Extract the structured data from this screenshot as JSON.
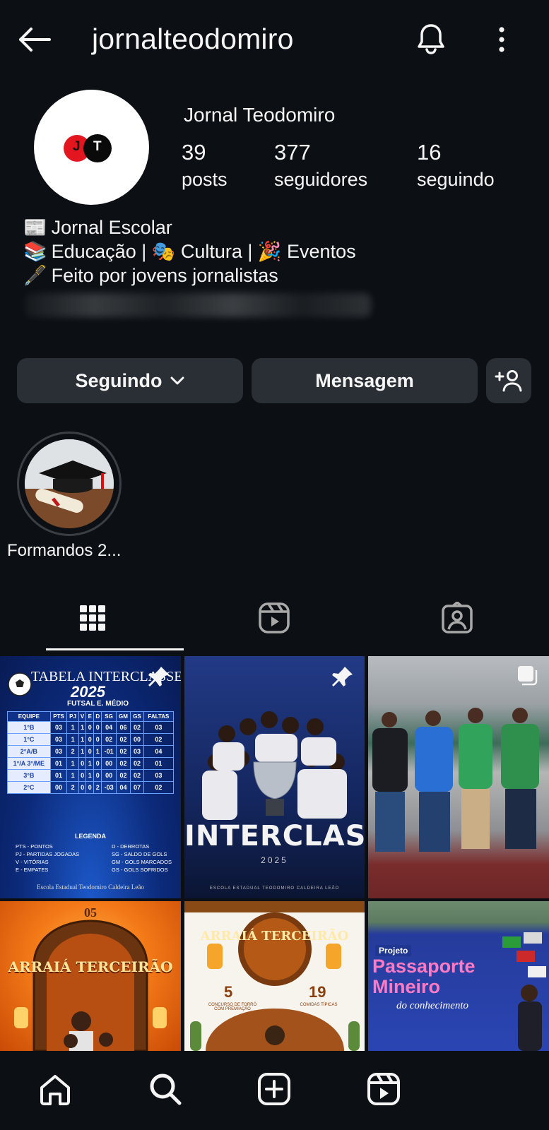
{
  "header": {
    "username": "jornalteodomiro",
    "icons": {
      "back": "arrow-left-icon",
      "bell": "bell-icon",
      "more": "more-vertical-icon"
    }
  },
  "profile": {
    "display_name": "Jornal Teodomiro",
    "avatar_logo": {
      "left_letter": "J",
      "right_letter": "T",
      "left_color": "#e3161f",
      "right_color": "#0a0a0a"
    },
    "stats": [
      {
        "value": "39",
        "label": "posts"
      },
      {
        "value": "377",
        "label": "seguidores"
      },
      {
        "value": "16",
        "label": "seguindo"
      }
    ],
    "bio": [
      {
        "emoji": "📰",
        "text": "Jornal Escolar"
      },
      {
        "emoji": "📚",
        "text": "Educação | 🎭 Cultura | 🎉 Eventos"
      },
      {
        "emoji": "🖋️",
        "text": "Feito por jovens jornalistas"
      }
    ]
  },
  "actions": {
    "following_label": "Seguindo",
    "message_label": "Mensagem"
  },
  "highlights": [
    {
      "label": "Formandos 2..."
    }
  ],
  "tabs": [
    {
      "name": "grid",
      "active": true
    },
    {
      "name": "reels",
      "active": false
    },
    {
      "name": "tagged",
      "active": false
    }
  ],
  "posts": [
    {
      "title": "TABELA INTERCLASSE",
      "year": "2025",
      "subtitle": "FUTSAL E. MÉDIO",
      "headers": [
        "EQUIPE",
        "PTS",
        "PJ",
        "V",
        "E",
        "D",
        "SG",
        "GM",
        "GS",
        "FALTAS"
      ],
      "rows": [
        [
          "1°B",
          "03",
          "1",
          "1",
          "0",
          "0",
          "04",
          "06",
          "02",
          "03"
        ],
        [
          "1°C",
          "03",
          "1",
          "1",
          "0",
          "0",
          "02",
          "02",
          "00",
          "02"
        ],
        [
          "2°A/B",
          "03",
          "2",
          "1",
          "0",
          "1",
          "-01",
          "02",
          "03",
          "04"
        ],
        [
          "1°/A 3°/ME",
          "01",
          "1",
          "0",
          "1",
          "0",
          "00",
          "02",
          "02",
          "01"
        ],
        [
          "3°B",
          "01",
          "1",
          "0",
          "1",
          "0",
          "00",
          "02",
          "02",
          "03"
        ],
        [
          "2°C",
          "00",
          "2",
          "0",
          "0",
          "2",
          "-03",
          "04",
          "07",
          "02"
        ]
      ],
      "legend_title": "LEGENDA",
      "legend": [
        "PTS - PONTOS",
        "PJ - PARTIDAS JOGADAS",
        "V - VITÓRIAS",
        "E - EMPATES",
        "D - DERROTAS",
        "SG - SALDO DE GOLS",
        "GM - GOLS MARCADOS",
        "GS - GOLS SOFRIDOS"
      ],
      "footer": "Escola Estadual Teodomiro Caldeira Leão",
      "pinned": true
    },
    {
      "title": "INTERCLASSE",
      "year": "2025",
      "footer": "ESCOLA ESTADUAL TEODOMIRO CALDEIRA LEÃO",
      "pinned": true
    },
    {
      "title": "",
      "type": "photo",
      "multi": true
    },
    {
      "title": "ARRAIÁ TERCEIRÃO",
      "date": "05"
    },
    {
      "title": "ARRAIÁ TERCEIRÃO",
      "left_num": "5",
      "left_caption": "CONCURSO DE FORRÓ COM PREMIAÇÃO",
      "right_num": "19",
      "right_caption": "COMIDAS TÍPICAS"
    },
    {
      "title_small": "Projeto",
      "title": "Passaporte Mineiro",
      "subtitle": "do conhecimento"
    }
  ],
  "bottom_nav": [
    "home-icon",
    "search-icon",
    "create-icon",
    "reels-icon"
  ],
  "colors": {
    "background": "#0c1014",
    "button": "#2a2f35",
    "text": "#f5f5f5"
  }
}
